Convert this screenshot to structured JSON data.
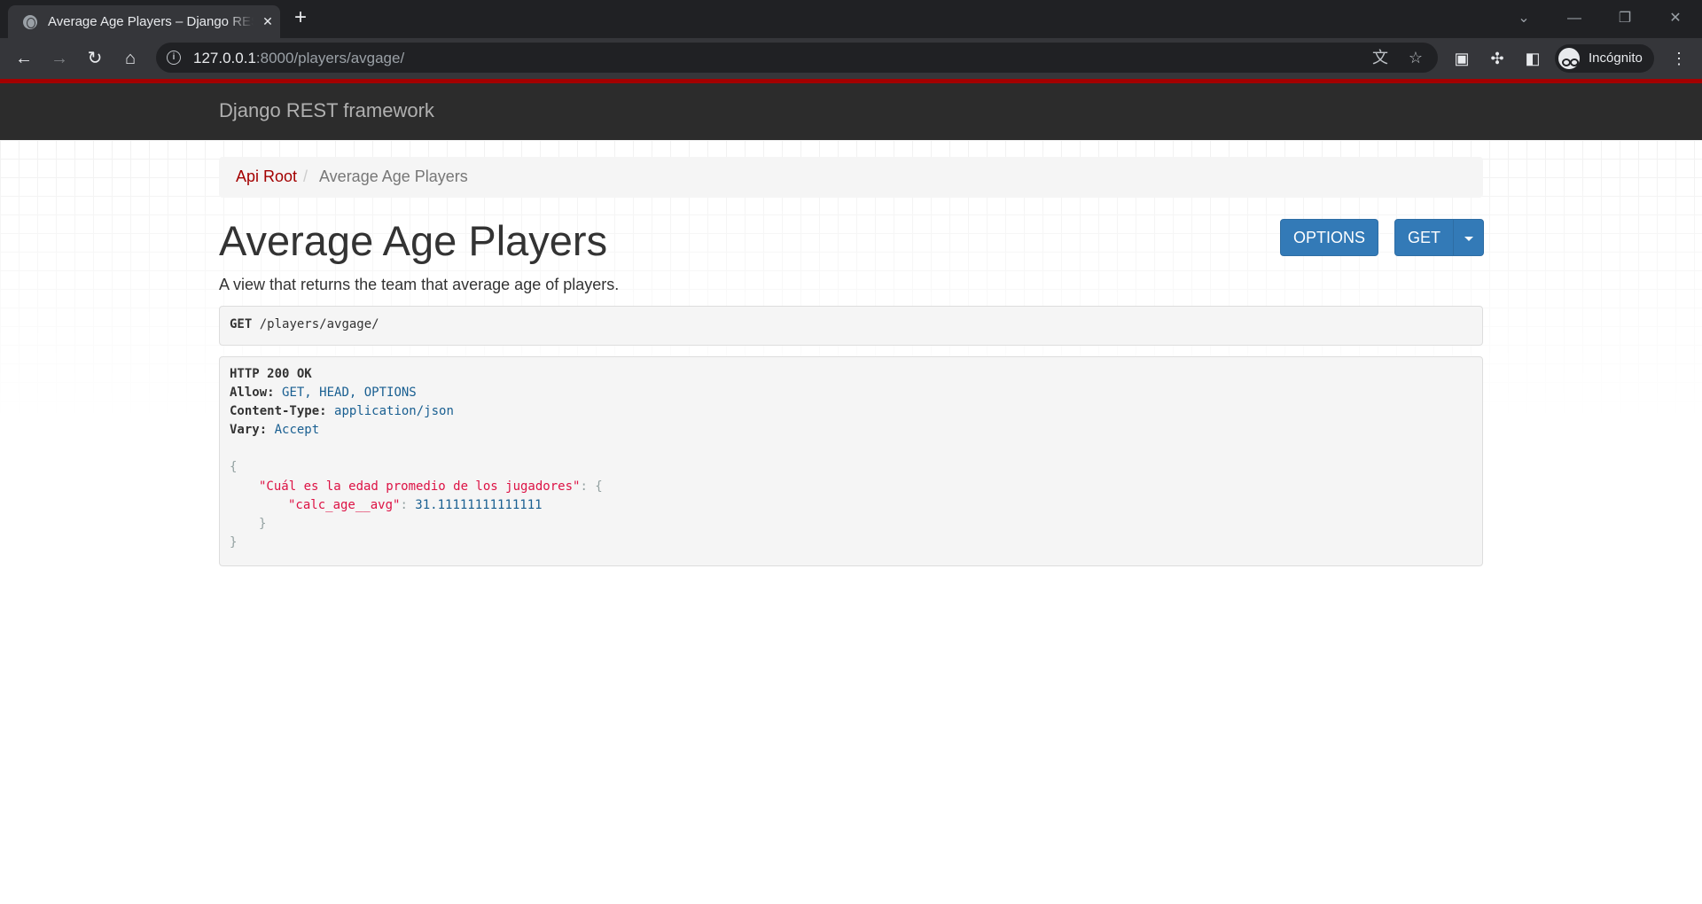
{
  "browser": {
    "tab_title": "Average Age Players – Django REST framework",
    "new_tab_symbol": "+",
    "close_symbol": "✕",
    "url_host": "127.0.0.1",
    "url_rest": ":8000/players/avgage/",
    "profile_label": "Incógnito"
  },
  "navbar": {
    "brand": "Django REST framework"
  },
  "breadcrumb": {
    "root": "Api Root",
    "separator": "/",
    "current": "Average Age Players"
  },
  "content": {
    "title": "Average Age Players",
    "description": "A view that returns the team that average age of players.",
    "options_button": "OPTIONS",
    "get_button": "GET"
  },
  "request": {
    "method": "GET",
    "path": "/players/avgage/"
  },
  "response": {
    "status": "HTTP 200 OK",
    "allow_key": "Allow:",
    "allow_value": "GET, HEAD, OPTIONS",
    "content_type_key": "Content-Type:",
    "content_type_value": "application/json",
    "vary_key": "Vary:",
    "vary_value": "Accept",
    "open_brace": "{",
    "outer_key": "\"Cuál es la edad promedio de los jugadores\"",
    "colon_brace": ": {",
    "inner_key": "\"calc_age__avg\"",
    "colon": ": ",
    "inner_value": "31.11111111111111",
    "close_inner": "}",
    "close_outer": "}"
  }
}
